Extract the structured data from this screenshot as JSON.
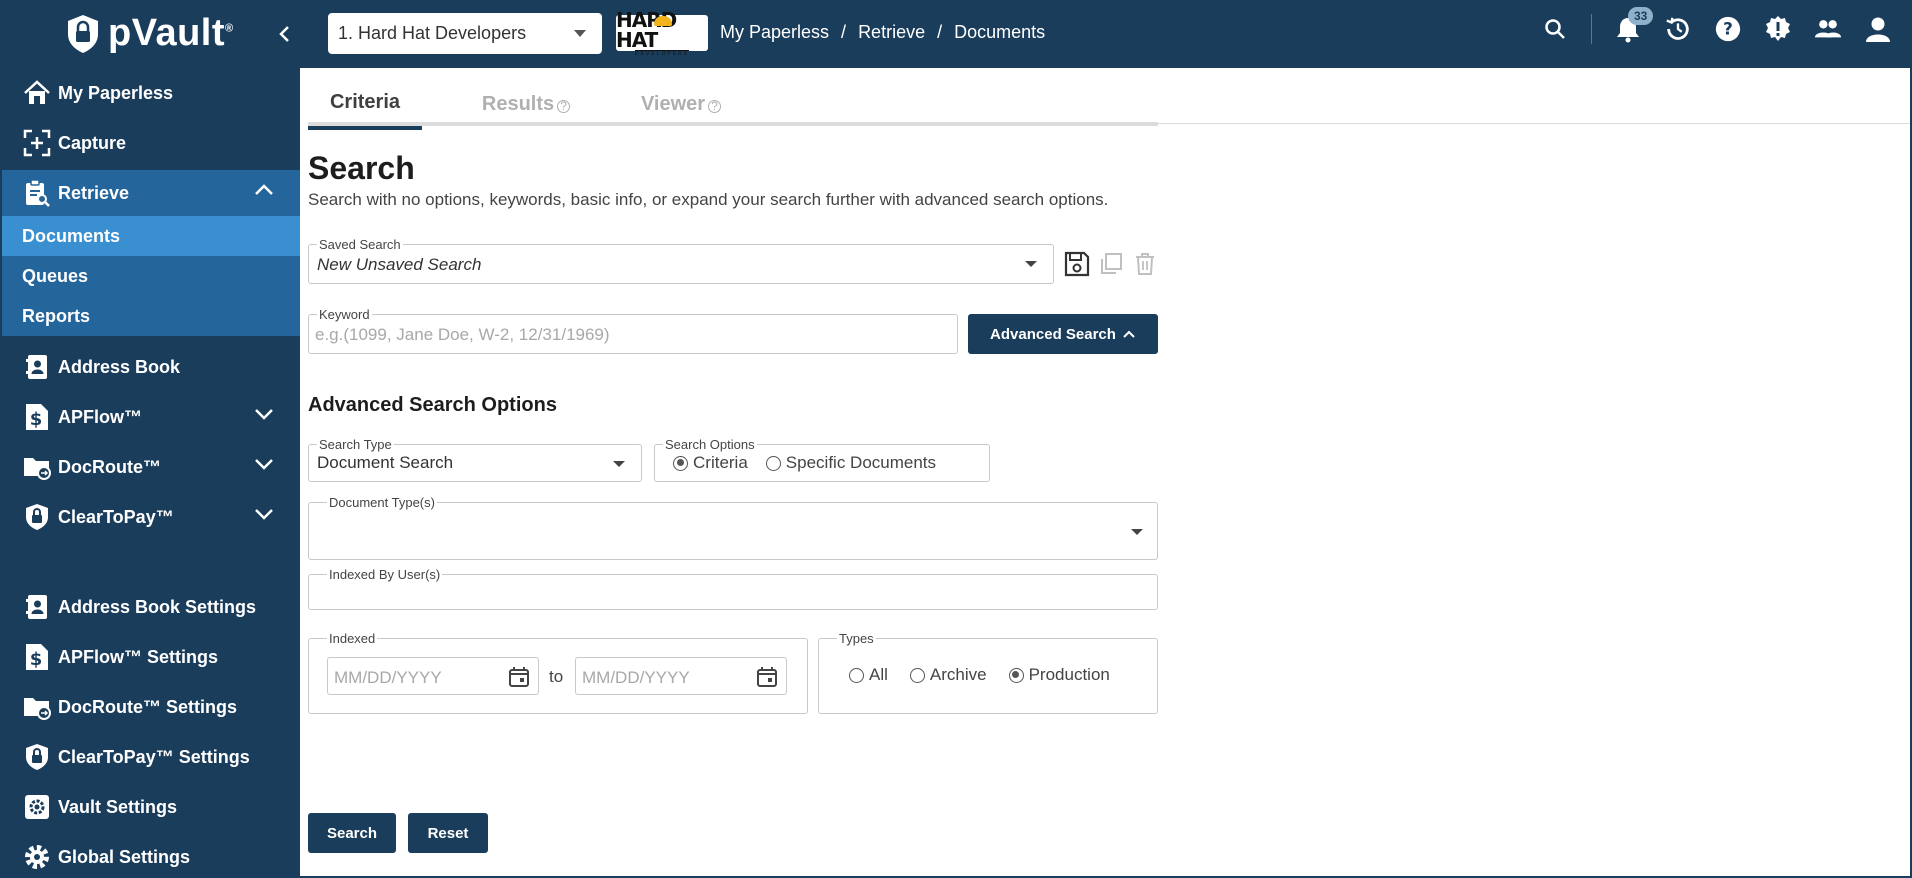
{
  "app": {
    "name": "pVault",
    "trademark": "®",
    "company_select": "1. Hard Hat Developers",
    "company_logo_main": "HARD HAT",
    "company_logo_sub": "DEVELOPERS",
    "notification_count": "33"
  },
  "breadcrumb": [
    "My Paperless",
    "Retrieve",
    "Documents"
  ],
  "breadcrumb_sep": "/",
  "sidebar": {
    "items": [
      {
        "label": "My Paperless",
        "icon": "home-icon"
      },
      {
        "label": "Capture",
        "icon": "capture-icon"
      },
      {
        "label": "Retrieve",
        "icon": "clipboard-search-icon"
      },
      {
        "label": "Address Book",
        "icon": "address-book-icon"
      },
      {
        "label": "APFlow™",
        "icon": "dollar-doc-icon"
      },
      {
        "label": "DocRoute™",
        "icon": "folder-route-icon"
      },
      {
        "label": "ClearToPay™",
        "icon": "shield-lock-icon"
      },
      {
        "label": "Address Book Settings",
        "icon": "address-book-icon"
      },
      {
        "label": "APFlow™ Settings",
        "icon": "dollar-doc-icon"
      },
      {
        "label": "DocRoute™ Settings",
        "icon": "folder-route-icon"
      },
      {
        "label": "ClearToPay™ Settings",
        "icon": "shield-lock-icon"
      },
      {
        "label": "Vault Settings",
        "icon": "gear-square-icon"
      },
      {
        "label": "Global Settings",
        "icon": "gear-icon"
      }
    ],
    "retrieve_sub": [
      "Documents",
      "Queues",
      "Reports"
    ]
  },
  "tabs": [
    {
      "label": "Criteria"
    },
    {
      "label": "Results"
    },
    {
      "label": "Viewer"
    }
  ],
  "tab_help": "?",
  "search": {
    "title": "Search",
    "subtitle": "Search with no options, keywords, basic info, or expand your search further with advanced search options.",
    "saved_search_label": "Saved Search",
    "saved_search_value": "New Unsaved Search",
    "keyword_label": "Keyword",
    "keyword_placeholder": "e.g.(1099, Jane Doe, W-2, 12/31/1969)",
    "advanced_button": "Advanced Search"
  },
  "advanced": {
    "title": "Advanced Search Options",
    "search_type_label": "Search Type",
    "search_type_value": "Document Search",
    "search_options_label": "Search Options",
    "search_options": [
      "Criteria",
      "Specific Documents"
    ],
    "search_options_selected": "Criteria",
    "document_types_label": "Document Type(s)",
    "indexed_by_label": "Indexed By User(s)",
    "indexed_label": "Indexed",
    "date_placeholder": "MM/DD/YYYY",
    "to_label": "to",
    "types_label": "Types",
    "types": [
      "All",
      "Archive",
      "Production"
    ],
    "types_selected": "Production"
  },
  "actions": {
    "search": "Search",
    "reset": "Reset"
  }
}
